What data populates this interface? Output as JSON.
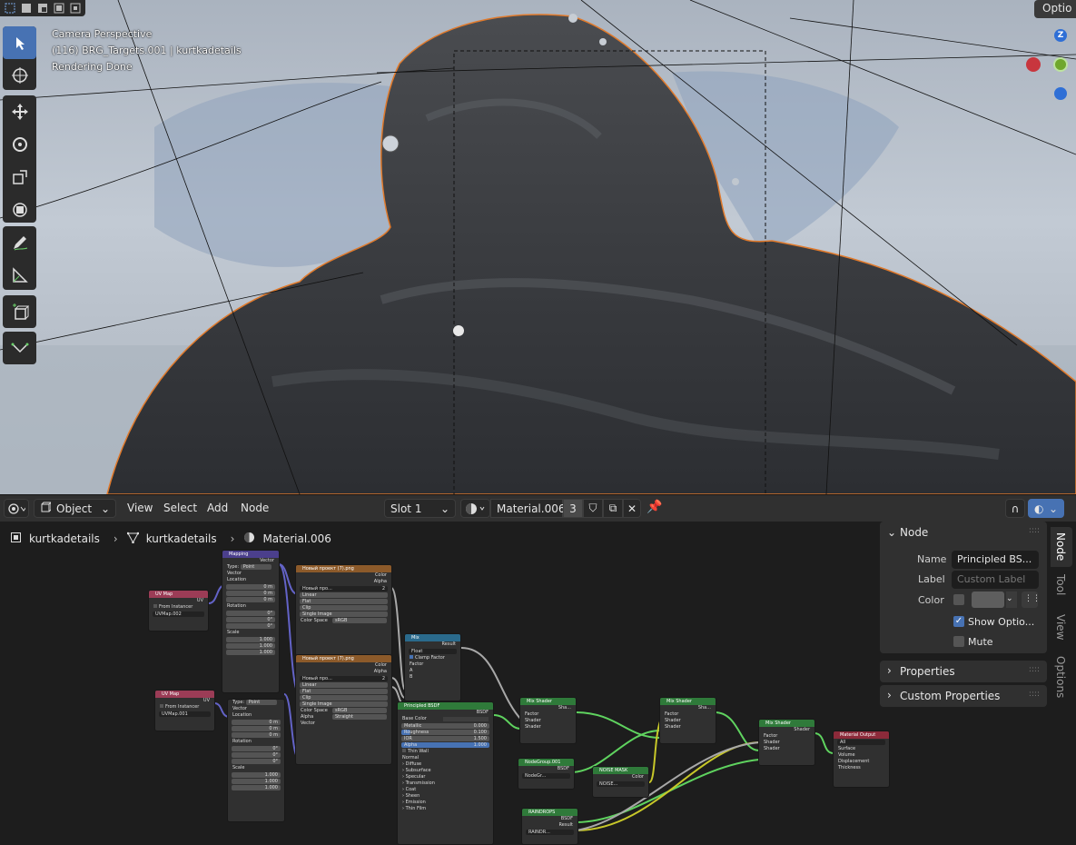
{
  "viewport": {
    "camera_label": "Camera Perspective",
    "object_label": "(116) BRG_Targets.001 | kurtkadetails",
    "render_status": "Rendering Done",
    "options_label": "Optio",
    "gizmo": {
      "z": "Z"
    }
  },
  "header": {
    "editor_type": "Object",
    "menus": [
      "View",
      "Select",
      "Add",
      "Node"
    ],
    "slot": "Slot 1",
    "material": "Material.006",
    "users_count": "3"
  },
  "breadcrumb": [
    "kurtkadetails",
    "kurtkadetails",
    "Material.006"
  ],
  "nodes": {
    "uvmap1": {
      "title": "UV Map",
      "out": "UV",
      "from_instancer": "From Instancer",
      "map": "UVMap.002"
    },
    "uvmap2": {
      "title": "UV Map",
      "out": "UV",
      "from_instancer": "From Instancer",
      "map": "UVMap.001"
    },
    "mapping1": {
      "title": "Mapping",
      "vector_out": "Vector",
      "type_label": "Type:",
      "type": "Point",
      "vector_in": "Vector",
      "location": "Location",
      "rotation": "Rotation",
      "scale": "Scale",
      "loc": [
        "0 m",
        "0 m",
        "0 m"
      ],
      "rot": [
        "0°",
        "0°",
        "0°"
      ],
      "scl": [
        "1.000",
        "1.000",
        "1.000"
      ]
    },
    "mapping2": {
      "type_label": "Type:",
      "type": "Point",
      "vector_in": "Vector",
      "location": "Location",
      "rotation": "Rotation",
      "scale": "Scale",
      "loc": [
        "0 m",
        "0 m",
        "0 m"
      ],
      "rot": [
        "0°",
        "0°",
        "0°"
      ],
      "scl": [
        "1.000",
        "1.000",
        "1.000"
      ]
    },
    "img1": {
      "title": "Новый проект (7).png",
      "color": "Color",
      "alpha": "Alpha",
      "image": "Новый про...",
      "users": "2",
      "interp": "Linear",
      "proj": "Flat",
      "ext": "Clip",
      "source": "Single Image",
      "cs_label": "Color Space",
      "cs": "sRGB"
    },
    "img2": {
      "title": "Новый проект (7).png",
      "color": "Color",
      "alpha": "Alpha",
      "image": "Новый про...",
      "users": "2",
      "interp": "Linear",
      "proj": "Flat",
      "ext": "Clip",
      "source": "Single Image",
      "cs_label": "Color Space",
      "cs": "sRGB",
      "alpha_label": "Alpha",
      "alpha_mode": "Straight",
      "vector": "Vector"
    },
    "mix": {
      "title": "Mix",
      "result": "Result",
      "dtype": "Float",
      "clamp": "Clamp Factor",
      "factor": "Factor",
      "a": "A",
      "b": "B"
    },
    "bsdf": {
      "title": "Principled BSDF",
      "out": "BSDF",
      "base_color": "Base Color",
      "metallic": "Metallic",
      "metallic_v": "0.000",
      "roughness": "Roughness",
      "roughness_v": "0.100",
      "ior": "IOR",
      "ior_v": "1.500",
      "alpha": "Alpha",
      "alpha_v": "1.000",
      "thin_wall": "Thin Wall",
      "normal": "Normal",
      "subpanels": [
        "Diffuse",
        "Subsurface",
        "Specular",
        "Transmission",
        "Coat",
        "Sheen",
        "Emission",
        "Thin Film"
      ]
    },
    "mixshader1": {
      "title": "Mix Shader",
      "out": "Sha...",
      "factor": "Factor",
      "shader_a": "Shader",
      "shader_b": "Shader"
    },
    "mixshader2": {
      "title": "Mix Shader",
      "out": "Sha...",
      "factor": "Factor",
      "shader_a": "Shader",
      "shader_b": "Shader"
    },
    "mixshader3": {
      "title": "Mix Shader",
      "out": "Shader",
      "factor": "Factor",
      "shader_a": "Shader",
      "shader_b": "Shader"
    },
    "group1": {
      "title": "NodeGroup.001",
      "out": "BSDF",
      "name": "NodeGr..."
    },
    "noise": {
      "title": "NOISE MASK",
      "out": "Color",
      "name": "NOISE..."
    },
    "raindrops": {
      "title": "RAINDROPS",
      "out1": "BSDF",
      "out2": "Result",
      "name": "RAINDR..."
    },
    "output": {
      "title": "Material Output",
      "target": "All",
      "surface": "Surface",
      "volume": "Volume",
      "displacement": "Displacement",
      "thickness": "Thickness"
    }
  },
  "sidepanel": {
    "node_section": "Node",
    "name_label": "Name",
    "name_value": "Principled BS...",
    "label_label": "Label",
    "label_placeholder": "Custom Label",
    "color_label": "Color",
    "show_options": "Show Optio...",
    "mute": "Mute",
    "properties": "Properties",
    "custom_properties": "Custom Properties"
  },
  "tabs": [
    "Node",
    "Tool",
    "View",
    "Options"
  ],
  "colors": {
    "accent": "#4772b3",
    "selection_outline": "#e07a2c",
    "shader_wire": "#5fd35f",
    "float_wire": "#a8a8a8",
    "vector_wire": "#6363c7",
    "color_wire": "#c7c729"
  }
}
